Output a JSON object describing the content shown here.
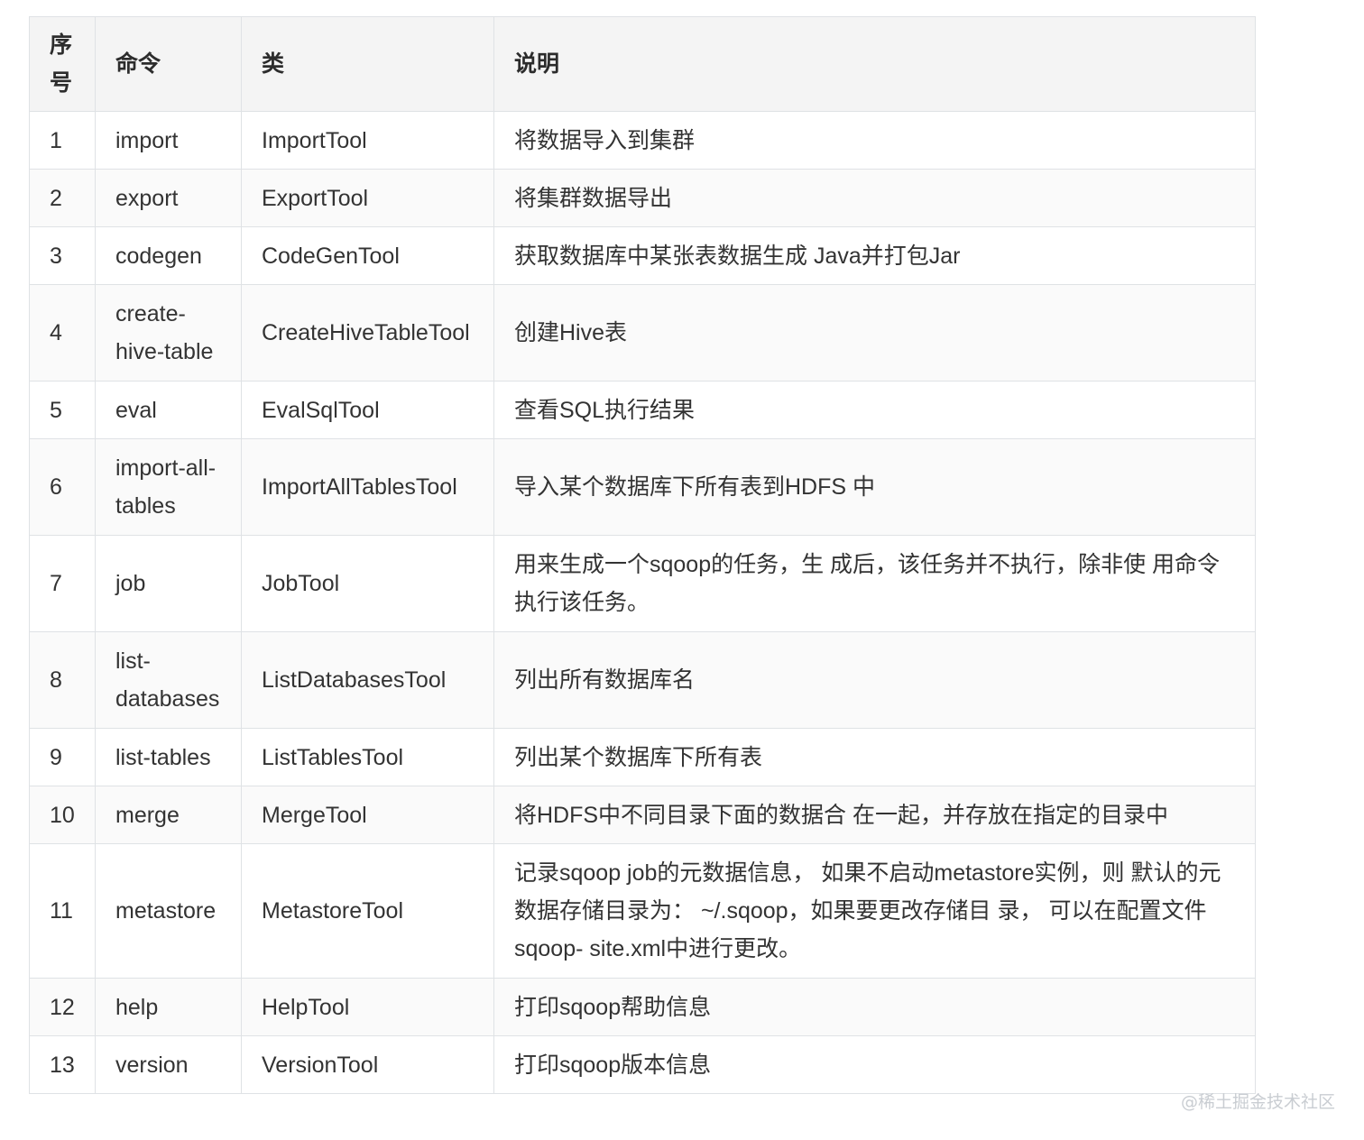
{
  "table": {
    "headers": [
      "序号",
      "命令",
      "类",
      "说明"
    ],
    "rows": [
      {
        "no": "1",
        "command": "import",
        "class": "ImportTool",
        "description": "将数据导入到集群"
      },
      {
        "no": "2",
        "command": "export",
        "class": "ExportTool",
        "description": "将集群数据导出"
      },
      {
        "no": "3",
        "command": "codegen",
        "class": "CodeGenTool",
        "description": "获取数据库中某张表数据生成 Java并打包Jar"
      },
      {
        "no": "4",
        "command": "create-hive-table",
        "class": "CreateHiveTableTool",
        "description": "创建Hive表"
      },
      {
        "no": "5",
        "command": "eval",
        "class": "EvalSqlTool",
        "description": "查看SQL执行结果"
      },
      {
        "no": "6",
        "command": "import-all-tables",
        "class": "ImportAllTablesTool",
        "description": "导入某个数据库下所有表到HDFS 中"
      },
      {
        "no": "7",
        "command": "job",
        "class": "JobTool",
        "description": "用来生成一个sqoop的任务，生 成后，该任务并不执行，除非使 用命令执行该任务。"
      },
      {
        "no": "8",
        "command": "list-databases",
        "class": "ListDatabasesTool",
        "description": "列出所有数据库名"
      },
      {
        "no": "9",
        "command": "list-tables",
        "class": "ListTablesTool",
        "description": "列出某个数据库下所有表"
      },
      {
        "no": "10",
        "command": "merge",
        "class": "MergeTool",
        "description": "将HDFS中不同目录下面的数据合 在一起，并存放在指定的目录中"
      },
      {
        "no": "11",
        "command": "metastore",
        "class": "MetastoreTool",
        "description": "记录sqoop job的元数据信息， 如果不启动metastore实例，则 默认的元数据存储目录为： ~/.sqoop，如果要更改存储目 录， 可以在配置文件sqoop- site.xml中进行更改。"
      },
      {
        "no": "12",
        "command": "help",
        "class": "HelpTool",
        "description": "打印sqoop帮助信息"
      },
      {
        "no": "13",
        "command": "version",
        "class": "VersionTool",
        "description": "打印sqoop版本信息"
      }
    ]
  },
  "watermark": "@稀土掘金技术社区"
}
